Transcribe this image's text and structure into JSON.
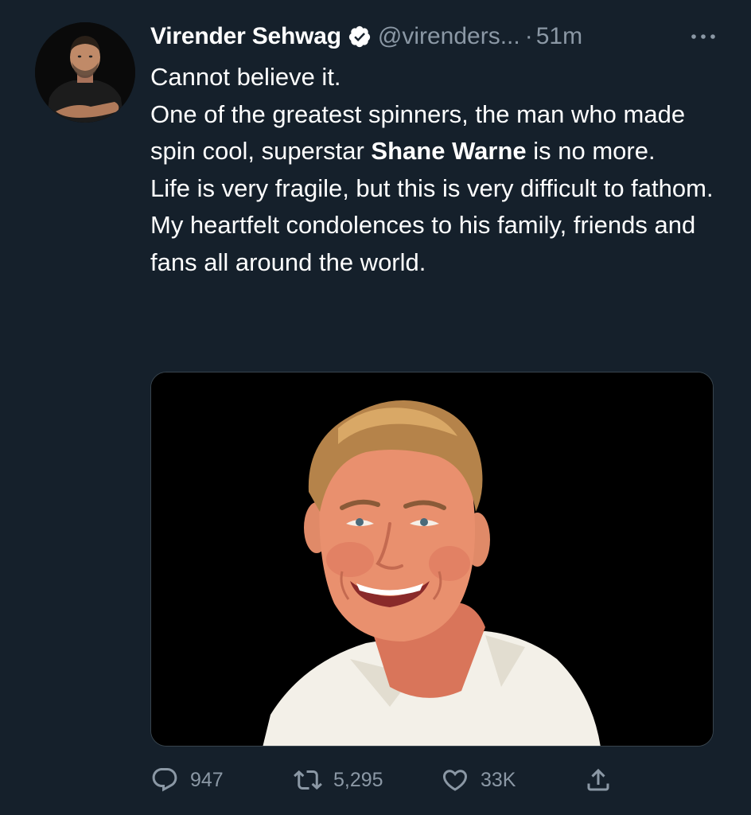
{
  "author": {
    "display_name": "Virender Sehwag",
    "handle": "@virenders...",
    "separator": "·",
    "time": "51m"
  },
  "tweet": {
    "line1": "Cannot believe it.",
    "line2_pre": "One of the greatest spinners, the man who made spin cool, superstar ",
    "line2_bold": "Shane Warne",
    "line2_post": " is no more.",
    "line3": "Life is very fragile, but this is very difficult to fathom. My heartfelt condolences to his family, friends and fans all around the world."
  },
  "actions": {
    "replies": "947",
    "retweets": "5,295",
    "likes": "33K"
  },
  "icons": {
    "verified": "verified-badge-icon",
    "more": "more-options-icon",
    "reply": "reply-icon",
    "retweet": "retweet-icon",
    "like": "heart-icon",
    "share": "share-icon"
  },
  "colors": {
    "background": "#15202b",
    "secondary_text": "#8b98a5",
    "verified_badge": "#ffffff"
  }
}
